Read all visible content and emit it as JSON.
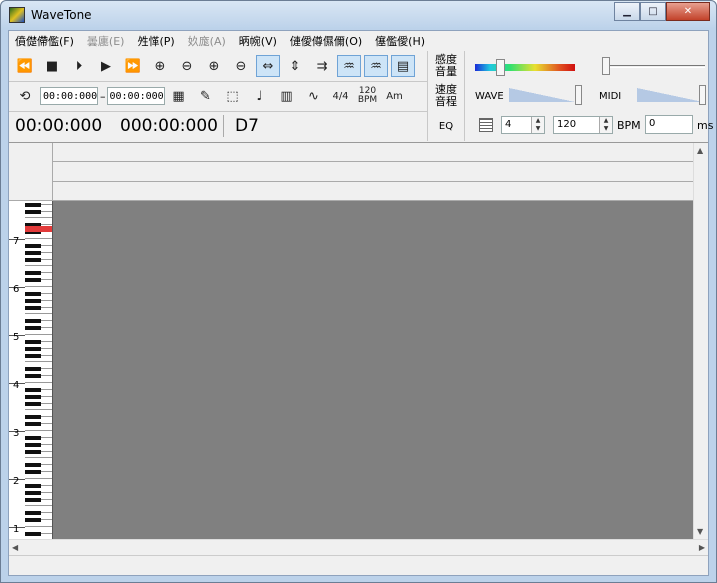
{
  "window": {
    "title": "WaveTone"
  },
  "caption_buttons": {
    "minimize": "▁",
    "maximize": "□",
    "close": "✕"
  },
  "menu": [
    {
      "label": "僨儊僀儖(F)",
      "enabled": true
    },
    {
      "label": "曇廤(E)",
      "enabled": false
    },
    {
      "label": "夝愅(P)",
      "enabled": true
    },
    {
      "label": "奺庬(A)",
      "enabled": false
    },
    {
      "label": "昞帵(V)",
      "enabled": true
    },
    {
      "label": "僆僾僔儑儞(O)",
      "enabled": true
    },
    {
      "label": "僿儖僾(H)",
      "enabled": true
    }
  ],
  "toolbar1": {
    "rewind": "⏪",
    "stop": "■",
    "step": "⏵",
    "play": "▶",
    "ffwd": "⏩",
    "zoom_in_h": "⊕",
    "zoom_out_h": "⊖",
    "zoom_in_v": "⊕",
    "zoom_out_v": "⊖",
    "fit_h": "⇔",
    "fit_v": "⇕",
    "swap": "⇉",
    "wave1": "♒",
    "wave2": "♒",
    "book": "▤"
  },
  "toolbar2": {
    "loop": "⟲",
    "start_time": "00:00:000",
    "dash": "–",
    "end_time": "00:00:000",
    "layout": "▦",
    "pencil": "✎",
    "select": "⬚",
    "note": "♩",
    "table": "▥",
    "curve": "∿",
    "time_sig": "4/4",
    "bpm_top": "120",
    "bpm_bottom": "BPM",
    "key": "Am"
  },
  "timebar": {
    "time1": "00:00:000",
    "time2": "000:00:000",
    "note": "D7"
  },
  "side_buttons": {
    "sensitivity_vol": "感度\n音量",
    "speed_pitch": "速度\n音程",
    "eq": "EQ"
  },
  "right_panel": {
    "meter_level": 0.25,
    "volume_level": 0.0,
    "wave_label": "WAVE",
    "midi_label": "MIDI",
    "beats": "4",
    "bpm_value": "120",
    "bpm_label": "BPM",
    "offset_value": "0",
    "ms_label": "ms"
  },
  "piano": {
    "octaves": [
      "7",
      "6",
      "5",
      "4",
      "3",
      "2",
      "1"
    ],
    "highlight_note": "D7"
  },
  "scroll": {
    "up": "▲",
    "down": "▼",
    "left": "◀",
    "right": "▶"
  }
}
